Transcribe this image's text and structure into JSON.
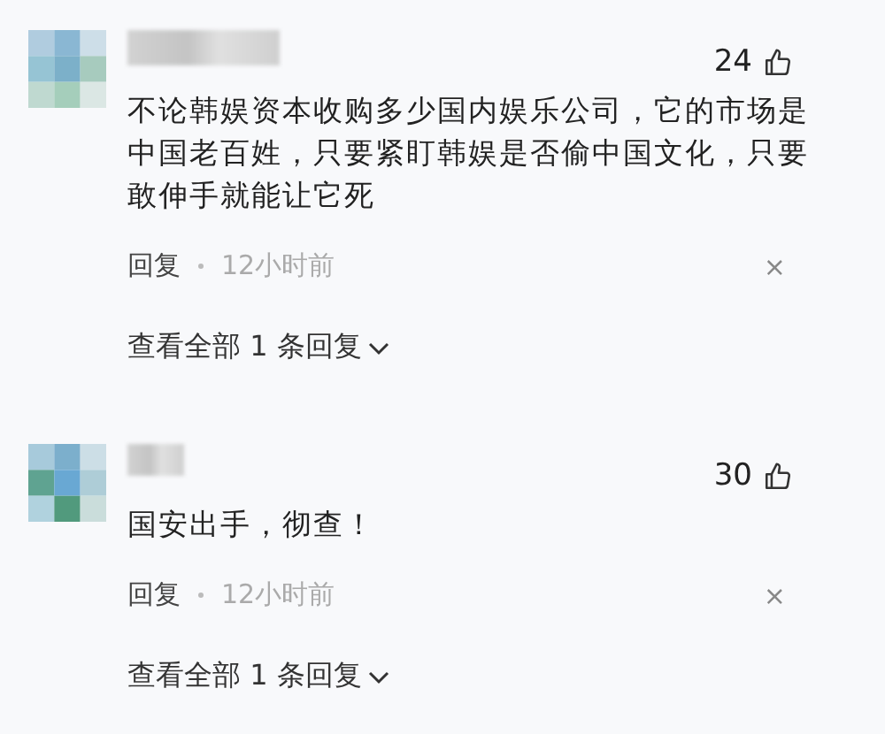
{
  "comments": [
    {
      "likes": "24",
      "text": "不论韩娱资本收购多少国内娱乐公司，它的市场是中国老百姓，只要紧盯韩娱是否偷中国文化，只要敢伸手就能让它死",
      "reply": "回复",
      "time": "12小时前",
      "close": "×",
      "view_replies": "查看全部 1 条回复"
    },
    {
      "likes": "30",
      "text": "国安出手，彻查！",
      "reply": "回复",
      "time": "12小时前",
      "close": "×",
      "view_replies": "查看全部 1 条回复"
    }
  ]
}
